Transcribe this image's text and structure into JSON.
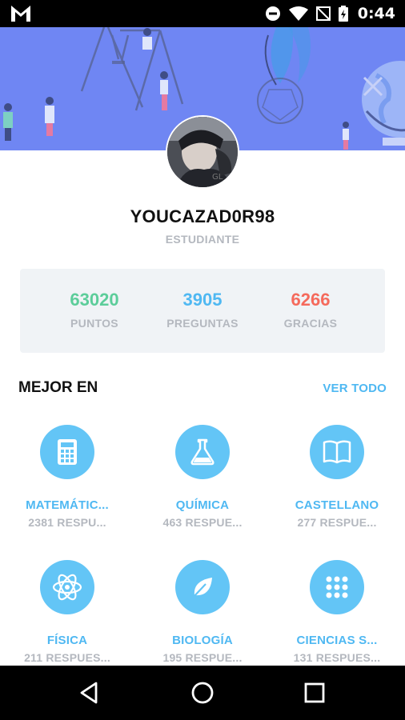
{
  "status_bar": {
    "time": "0:44",
    "icons": [
      "gmail-icon",
      "do-not-disturb-icon",
      "wifi-icon",
      "no-signal-icon",
      "battery-charging-icon"
    ]
  },
  "profile": {
    "username": "YOUCAZAD0R98",
    "role": "ESTUDIANTE"
  },
  "stats": [
    {
      "value": "63020",
      "label": "PUNTOS",
      "color": "#5ccd9a"
    },
    {
      "value": "3905",
      "label": "PREGUNTAS",
      "color": "#4fb8f2"
    },
    {
      "value": "6266",
      "label": "GRACIAS",
      "color": "#f56a5c"
    }
  ],
  "best_in": {
    "title": "MEJOR EN",
    "see_all": "VER TODO",
    "subjects": [
      {
        "name": "MATEMÁTIC...",
        "count": "2381 RESPU...",
        "icon": "calculator-icon"
      },
      {
        "name": "QUÍMICA",
        "count": "463 RESPUE...",
        "icon": "flask-icon"
      },
      {
        "name": "CASTELLANO",
        "count": "277 RESPUE...",
        "icon": "book-icon"
      },
      {
        "name": "FÍSICA",
        "count": "211 RESPUES...",
        "icon": "atom-icon"
      },
      {
        "name": "BIOLOGÍA",
        "count": "195 RESPUE...",
        "icon": "leaf-icon"
      },
      {
        "name": "CIENCIAS S...",
        "count": "131 RESPUES...",
        "icon": "grid-dots-icon"
      }
    ]
  },
  "colors": {
    "header_bg": "#6f86f3",
    "accent_blue": "#4fb8f2",
    "subject_circle": "#63c5f6",
    "muted_text": "#b4b8bf"
  },
  "nav": [
    "back-icon",
    "home-icon",
    "recents-icon"
  ]
}
